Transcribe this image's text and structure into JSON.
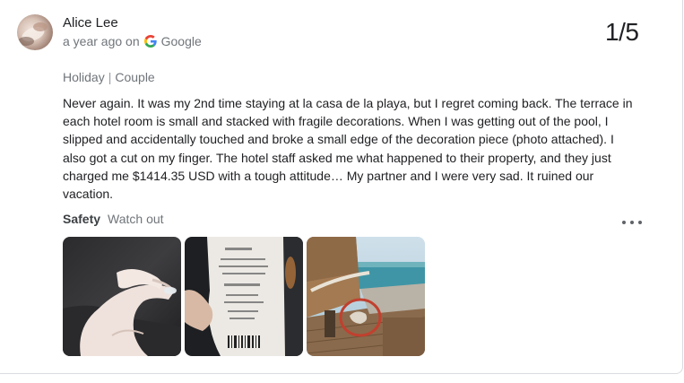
{
  "review": {
    "author": "Alice Lee",
    "time_ago": "a year ago on",
    "source": "Google",
    "pager": "1/5",
    "trip_type": "Holiday",
    "travel_group": "Couple",
    "text": "Never again. It was my 2nd time staying at la casa de la playa, but I regret coming back. The terrace in each hotel room is small and stacked with fragile decorations. When I was getting out of the pool, I slipped and accidentally touched and broke a small edge of the decoration piece (photo attached). I also got a cut on my finger. The hotel staff asked me what happened to their property, and they just charged me $1414.35 USD with a tough attitude… My partner and I were very sad. It ruined our vacation.",
    "attribute_key": "Safety",
    "attribute_value": "Watch out"
  },
  "icons": {
    "source_logo": "google-g-icon",
    "more": "more-horizontal-icon"
  },
  "photos": [
    {
      "name": "photo-hand-cut",
      "subject": "hand with cut finger"
    },
    {
      "name": "photo-receipt",
      "subject": "receipt"
    },
    {
      "name": "photo-terrace",
      "subject": "terrace with broken decoration"
    }
  ],
  "colors": {
    "text_primary": "#202124",
    "text_secondary": "#70757a",
    "google_blue": "#4285F4",
    "google_red": "#EA4335",
    "google_yellow": "#FBBC05",
    "google_green": "#34A853"
  }
}
